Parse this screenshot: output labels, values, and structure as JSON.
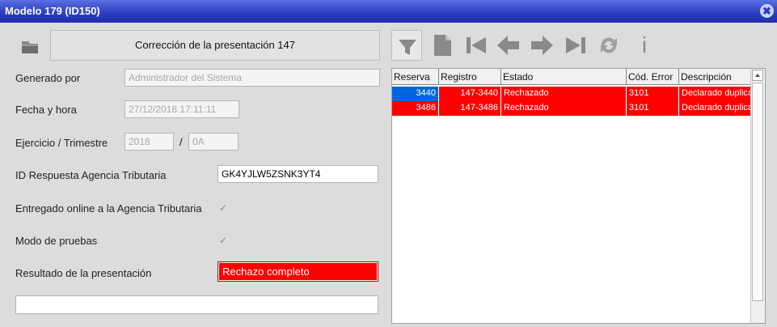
{
  "window": {
    "title": "Modelo 179 (ID150)",
    "close_glyph": "✖"
  },
  "header": {
    "folder_icon": "folder-icon",
    "presentation_button": "Corrección de la presentación 147"
  },
  "form": {
    "generado_por": {
      "label": "Generado por",
      "value": "Administrador del Sistema"
    },
    "fecha_hora": {
      "label": "Fecha y hora",
      "value": "27/12/2018  17:11:11"
    },
    "ejercicio": {
      "label": "Ejercicio / Trimestre",
      "year": "2018",
      "separator": "/",
      "period": "0A"
    },
    "id_respuesta": {
      "label": "ID Respuesta Agencia Tributaria",
      "value": "GK4YJLW5ZSNK3YT4"
    },
    "entregado_online": {
      "label": "Entregado online a la Agencia Tributaria",
      "checked": true,
      "glyph": "✓"
    },
    "modo_pruebas": {
      "label": "Modo de pruebas",
      "checked": true,
      "glyph": "✓"
    },
    "resultado": {
      "label": "Resultado de la presentación",
      "value": "Rechazo completo",
      "color": "#ff0000"
    },
    "notes": {
      "value": ""
    }
  },
  "toolbar": {
    "icons": [
      "filter-icon",
      "new-document-icon",
      "first-record-icon",
      "previous-record-icon",
      "next-record-icon",
      "last-record-icon",
      "refresh-icon",
      "info-icon"
    ],
    "info_glyph": "i"
  },
  "grid": {
    "columns": [
      "Reserva",
      "Registro",
      "Estado",
      "Cód. Error",
      "Descripción"
    ],
    "rows": [
      {
        "reserva": "3440",
        "registro": "147-3440",
        "estado": "Rechazado",
        "cod_error": "3101",
        "descripcion": "Declarado duplica",
        "selected": true
      },
      {
        "reserva": "3486",
        "registro": "147-3486",
        "estado": "Rechazado",
        "cod_error": "3101",
        "descripcion": "Declarado duplica",
        "selected": false
      }
    ],
    "row_color": "#ff0000",
    "selected_color": "#0066dd"
  }
}
